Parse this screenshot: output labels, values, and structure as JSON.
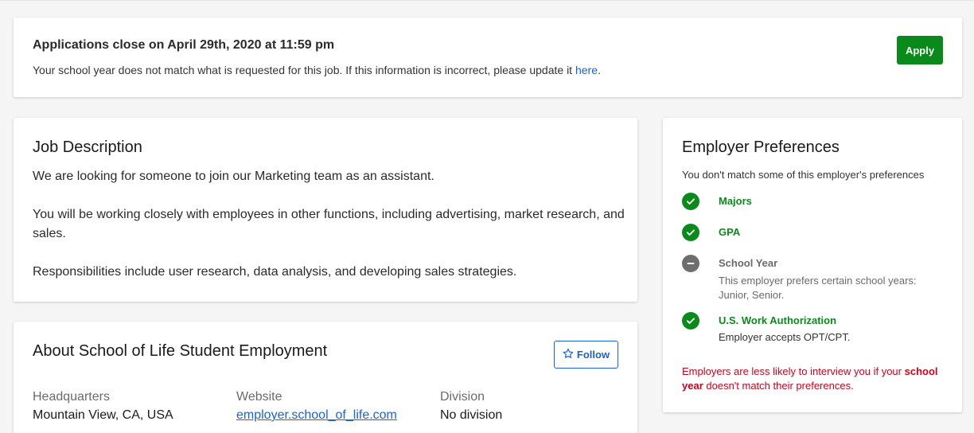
{
  "banner": {
    "title": "Applications close on April 29th, 2020 at 11:59 pm",
    "notice_text": "Your school year does not match what is requested for this job. If this information is incorrect, please update it",
    "notice_link": "here",
    "notice_end": ".",
    "apply_label": "Apply"
  },
  "job_description": {
    "title": "Job Description",
    "paragraphs": [
      "We are looking for someone to join our Marketing team as an assistant.",
      "You will be working closely with employees in other functions, including advertising, market research, and sales.",
      "Responsibilities include user research, data analysis, and developing sales strategies."
    ]
  },
  "about": {
    "title": "About School of Life Student Employment",
    "follow_label": "Follow",
    "headquarters_label": "Headquarters",
    "headquarters_value": "Mountain View, CA, USA",
    "website_label": "Website",
    "website_value": "employer.school_of_life.com",
    "division_label": "Division",
    "division_value": "No division"
  },
  "preferences": {
    "title": "Employer Preferences",
    "subtitle": "You don't match some of this employer's preferences",
    "items": [
      {
        "name": "Majors",
        "status": "match",
        "icon": "check-icon"
      },
      {
        "name": "GPA",
        "status": "match",
        "icon": "check-icon"
      },
      {
        "name": "School Year",
        "status": "mismatch",
        "icon": "minus-icon",
        "detail": "This employer prefers certain school years: Junior, Senior."
      },
      {
        "name": "U.S. Work Authorization",
        "status": "match",
        "icon": "check-icon",
        "detail": "Employer accepts OPT/CPT."
      }
    ],
    "warning_pre": "Employers are less likely to interview you if your",
    "warning_bold": "school year",
    "warning_post": "doesn't match their preferences."
  },
  "colors": {
    "accent_green": "#0a8a1a",
    "link_blue": "#1a62d6",
    "warning_red": "#d0021b",
    "neutral_gray": "#6e6e6e"
  }
}
